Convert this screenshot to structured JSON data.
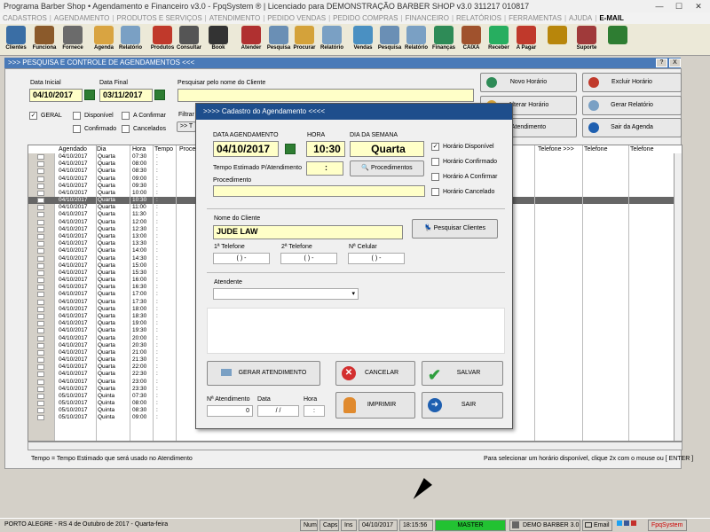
{
  "window": {
    "title": "Programa Barber Shop • Agendamento e Financeiro v3.0 - FpqSystem ® | Licenciado para  DEMONSTRAÇÃO BARBER SHOP v3.0 311217 010817",
    "min": "—",
    "max": "☐",
    "close": "✕"
  },
  "menu": [
    "CADASTROS",
    "AGENDAMENTO",
    "PRODUTOS E SERVIÇOS",
    "ATENDIMENTO",
    "PEDIDO VENDAS",
    "PEDIDO COMPRAS",
    "FINANCEIRO",
    "RELATÓRIOS",
    "FERRAMENTAS",
    "AJUDA",
    "E-MAIL"
  ],
  "toolbar": [
    {
      "label": "Clientes",
      "color": "#3a6ea5"
    },
    {
      "label": "Funciona",
      "color": "#8b5a2b"
    },
    {
      "label": "Fornece",
      "color": "#6b6b6b"
    },
    {
      "label": "Agenda",
      "color": "#d9a441"
    },
    {
      "label": "Relatório",
      "color": "#7aa0c4"
    },
    {
      "label": "Produtos",
      "color": "#c0392b"
    },
    {
      "label": "Consultar",
      "color": "#555555"
    },
    {
      "label": "Book",
      "color": "#333333"
    },
    {
      "label": "Atender",
      "color": "#b03030"
    },
    {
      "label": "Pesquisa",
      "color": "#6a8fb5"
    },
    {
      "label": "Procurar",
      "color": "#d4a23a"
    },
    {
      "label": "Relatório",
      "color": "#7aa0c4"
    },
    {
      "label": "Vendas",
      "color": "#4a90c2"
    },
    {
      "label": "Pesquisa",
      "color": "#6a8fb5"
    },
    {
      "label": "Relatório",
      "color": "#7aa0c4"
    },
    {
      "label": "Finanças",
      "color": "#2e8b57"
    },
    {
      "label": "CAIXA",
      "color": "#a0522d"
    },
    {
      "label": "Receber",
      "color": "#27ae60"
    },
    {
      "label": "A Pagar",
      "color": "#c0392b"
    },
    {
      "label": "",
      "color": "#b8860b"
    },
    {
      "label": "Suporte",
      "color": "#a03a3a"
    },
    {
      "label": "",
      "color": "#2e7d32"
    }
  ],
  "subheader": {
    "title": ">>>  PESQUISA E CONTROLE DE AGENDAMENTOS  <<<",
    "help": "?",
    "close": "X"
  },
  "filters": {
    "data_inicial_label": "Data Inicial",
    "data_inicial": "04/10/2017",
    "data_final_label": "Data Final",
    "data_final": "03/11/2017",
    "pesquisar_label": "Pesquisar pelo nome do Cliente",
    "pesquisar_value": "",
    "filtrar_label": "Filtrar p",
    "filtrar_btn": ">> T"
  },
  "checks": [
    {
      "label": "GERAL",
      "checked": true
    },
    {
      "label": "Disponível",
      "checked": false
    },
    {
      "label": "A Confirmar",
      "checked": false
    },
    {
      "label": "Confirmado",
      "checked": false
    },
    {
      "label": "Cancelados",
      "checked": false
    }
  ],
  "right_buttons": [
    {
      "label": "Novo Horário",
      "color": "#2e8b57"
    },
    {
      "label": "Excluir Horário",
      "color": "#c0392b"
    },
    {
      "label": "Alterar Horário",
      "color": "#d4a23a"
    },
    {
      "label": "Gerar Relatório",
      "color": "#7aa0c4"
    },
    {
      "label": "Atendimento",
      "color": "#3a6ea5"
    },
    {
      "label": "Sair da Agenda",
      "color": "#1e5fb0"
    }
  ],
  "grid": {
    "headers": [
      "Agendado",
      "Dia",
      "Hora",
      "Tempo",
      "Proced",
      "Telefone  >>>",
      "Telefone",
      "Telefone"
    ],
    "rows": [
      [
        "04/10/2017",
        "Quarta",
        "07:30",
        ":"
      ],
      [
        "04/10/2017",
        "Quarta",
        "08:00",
        ":"
      ],
      [
        "04/10/2017",
        "Quarta",
        "08:30",
        ":"
      ],
      [
        "04/10/2017",
        "Quarta",
        "09:00",
        ":"
      ],
      [
        "04/10/2017",
        "Quarta",
        "09:30",
        ":"
      ],
      [
        "04/10/2017",
        "Quarta",
        "10:00",
        ":"
      ],
      [
        "04/10/2017",
        "Quarta",
        "10:30",
        ":"
      ],
      [
        "04/10/2017",
        "Quarta",
        "11:00",
        ":"
      ],
      [
        "04/10/2017",
        "Quarta",
        "11:30",
        ":"
      ],
      [
        "04/10/2017",
        "Quarta",
        "12:00",
        ":"
      ],
      [
        "04/10/2017",
        "Quarta",
        "12:30",
        ":"
      ],
      [
        "04/10/2017",
        "Quarta",
        "13:00",
        ":"
      ],
      [
        "04/10/2017",
        "Quarta",
        "13:30",
        ":"
      ],
      [
        "04/10/2017",
        "Quarta",
        "14:00",
        ":"
      ],
      [
        "04/10/2017",
        "Quarta",
        "14:30",
        ":"
      ],
      [
        "04/10/2017",
        "Quarta",
        "15:00",
        ":"
      ],
      [
        "04/10/2017",
        "Quarta",
        "15:30",
        ":"
      ],
      [
        "04/10/2017",
        "Quarta",
        "16:00",
        ":"
      ],
      [
        "04/10/2017",
        "Quarta",
        "16:30",
        ":"
      ],
      [
        "04/10/2017",
        "Quarta",
        "17:00",
        ":"
      ],
      [
        "04/10/2017",
        "Quarta",
        "17:30",
        ":"
      ],
      [
        "04/10/2017",
        "Quarta",
        "18:00",
        ":"
      ],
      [
        "04/10/2017",
        "Quarta",
        "18:30",
        ":"
      ],
      [
        "04/10/2017",
        "Quarta",
        "19:00",
        ":"
      ],
      [
        "04/10/2017",
        "Quarta",
        "19:30",
        ":"
      ],
      [
        "04/10/2017",
        "Quarta",
        "20:00",
        ":"
      ],
      [
        "04/10/2017",
        "Quarta",
        "20:30",
        ":"
      ],
      [
        "04/10/2017",
        "Quarta",
        "21:00",
        ":"
      ],
      [
        "04/10/2017",
        "Quarta",
        "21:30",
        ":"
      ],
      [
        "04/10/2017",
        "Quarta",
        "22:00",
        ":"
      ],
      [
        "04/10/2017",
        "Quarta",
        "22:30",
        ":"
      ],
      [
        "04/10/2017",
        "Quarta",
        "23:00",
        ":"
      ],
      [
        "04/10/2017",
        "Quarta",
        "23:30",
        ":"
      ],
      [
        "05/10/2017",
        "Quinta",
        "07:30",
        ":"
      ],
      [
        "05/10/2017",
        "Quinta",
        "08:00",
        ":"
      ],
      [
        "05/10/2017",
        "Quinta",
        "08:30",
        ":"
      ],
      [
        "05/10/2017",
        "Quinta",
        "09:00",
        ":"
      ]
    ],
    "selected_row": 6
  },
  "footer": {
    "left": "Tempo = Tempo Estimado que será usado no Atendimento",
    "right": "Para selecionar um horário disponível, clique 2x com o mouse ou [ ENTER ]"
  },
  "dialog": {
    "title": ">>>>   Cadastro do Agendamento   <<<<",
    "data_label": "DATA AGENDAMENTO",
    "data": "04/10/2017",
    "hora_label": "HORA",
    "hora": "10:30",
    "dia_label": "DIA DA SEMANA",
    "dia": "Quarta",
    "tempo_label": "Tempo Estimado P/Atendimento",
    "tempo": ":",
    "procedimentos_btn": "Procedimentos",
    "procedimento_label": "Procedimento",
    "procedimento": "",
    "status": [
      {
        "label": "Horário Disponível",
        "checked": true
      },
      {
        "label": "Horário Confirmado",
        "checked": false
      },
      {
        "label": "Horário A Confirmar",
        "checked": false
      },
      {
        "label": "Horário Cancelado",
        "checked": false
      }
    ],
    "cliente_label": "Nome do Cliente",
    "cliente": "JUDE LAW",
    "pesquisar_btn": "Pesquisar Clientes",
    "tel1_label": "1ª Telefone",
    "tel1": "(   )    -",
    "tel2_label": "2ª Telefone",
    "tel2": "(   )    -",
    "cel_label": "Nª Celular",
    "cel": "(   )    -",
    "atendente_label": "Atendente",
    "atendente": "",
    "gerar_btn": "GERAR ATENDIMENTO",
    "cancelar_btn": "CANCELAR",
    "salvar_btn": "SALVAR",
    "imprimir_btn": "IMPRIMIR",
    "sair_btn": "SAIR",
    "num_label": "Nª Atendimento",
    "num": "0",
    "dt_label": "Data",
    "dt": "/ /",
    "hr_label": "Hora",
    "hr": ":"
  },
  "statusbar": {
    "city": "PORTO ALEGRE - RS   4 de Outubro de 2017 - Quarta-feira",
    "num": "Num",
    "caps": "Caps",
    "ins": "Ins",
    "date": "04/10/2017",
    "time": "18:15:56",
    "master": "MASTER",
    "demo": "DEMO BARBER 3.0",
    "email": "Email",
    "brand": "FpqSystem"
  }
}
